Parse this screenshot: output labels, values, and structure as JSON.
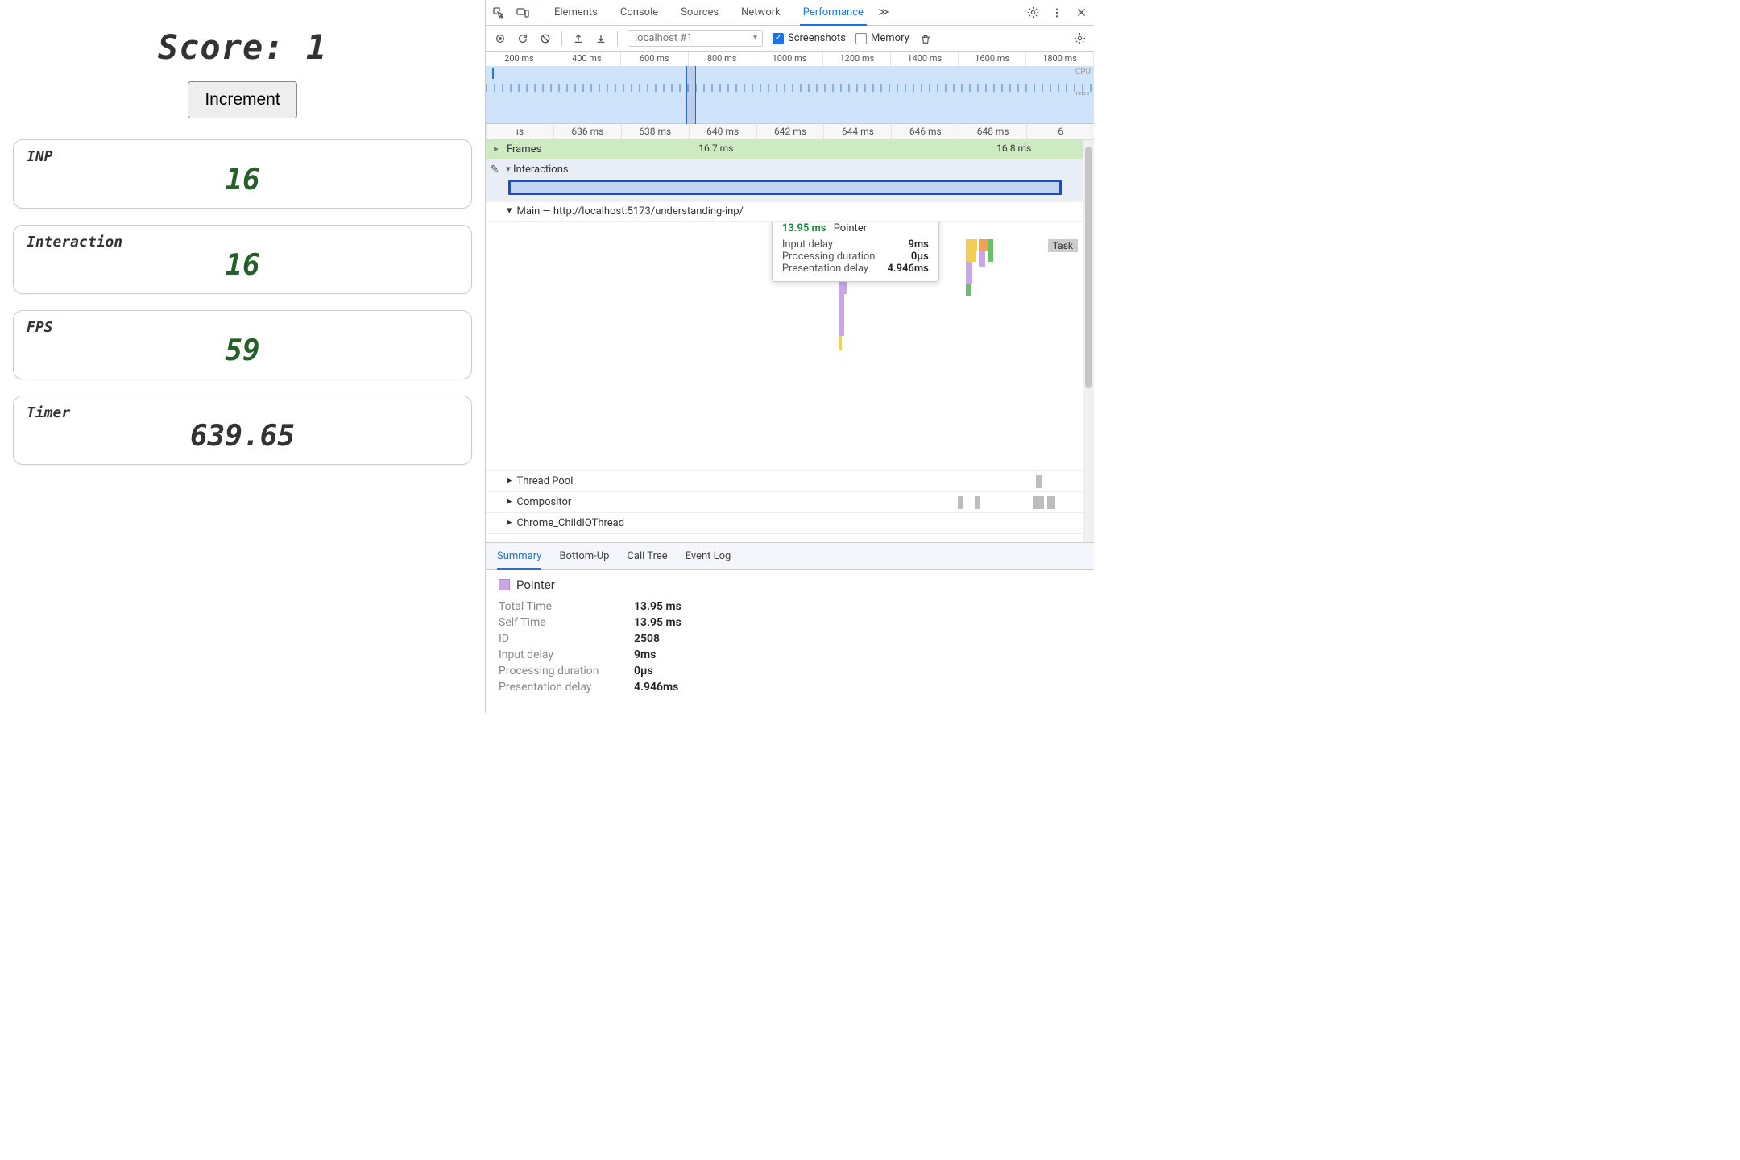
{
  "app": {
    "score_label": "Score: 1",
    "increment_label": "Increment",
    "cards": [
      {
        "label": "INP",
        "value": "16",
        "green": true
      },
      {
        "label": "Interaction",
        "value": "16",
        "green": true
      },
      {
        "label": "FPS",
        "value": "59",
        "green": true
      },
      {
        "label": "Timer",
        "value": "639.65",
        "green": false
      }
    ]
  },
  "devtools": {
    "tabs": [
      "Elements",
      "Console",
      "Sources",
      "Network",
      "Performance"
    ],
    "more_label": "≫",
    "active_tab": 4,
    "toolbar": {
      "profile_select": "localhost #1",
      "screenshots_label": "Screenshots",
      "memory_label": "Memory"
    },
    "overview": {
      "ticks": [
        "200 ms",
        "400 ms",
        "600 ms",
        "800 ms",
        "1000 ms",
        "1200 ms",
        "1400 ms",
        "1600 ms",
        "1800 ms"
      ],
      "cpu_label": "CPU",
      "net_label": "NET",
      "marker_left_pct": 33
    },
    "ruler": [
      "ıs",
      "636 ms",
      "638 ms",
      "640 ms",
      "642 ms",
      "644 ms",
      "646 ms",
      "648 ms",
      "6"
    ],
    "frames": {
      "title": "Frames",
      "vals": [
        "16.7 ms",
        "16.8 ms"
      ],
      "pos_pct": [
        35,
        84
      ]
    },
    "interactions": {
      "title": "Interactions"
    },
    "main": {
      "title": "Main — http://localhost:5173/understanding-inp/",
      "task_label": "Task"
    },
    "tooltip": {
      "ms": "13.95 ms",
      "type": "Pointer",
      "rows": [
        {
          "k": "Input delay",
          "v": "9ms"
        },
        {
          "k": "Processing duration",
          "v": "0µs"
        },
        {
          "k": "Presentation delay",
          "v": "4.946ms"
        }
      ]
    },
    "threads": [
      "Thread Pool",
      "Compositor",
      "Chrome_ChildIOThread"
    ],
    "detail_tabs": [
      "Summary",
      "Bottom-Up",
      "Call Tree",
      "Event Log"
    ],
    "summary": {
      "title": "Pointer",
      "rows": [
        {
          "k": "Total Time",
          "v": "13.95 ms"
        },
        {
          "k": "Self Time",
          "v": "13.95 ms"
        },
        {
          "k": "ID",
          "v": "2508"
        },
        {
          "k": "Input delay",
          "v": "9ms"
        },
        {
          "k": "Processing duration",
          "v": "0µs"
        },
        {
          "k": "Presentation delay",
          "v": "4.946ms"
        }
      ]
    }
  }
}
